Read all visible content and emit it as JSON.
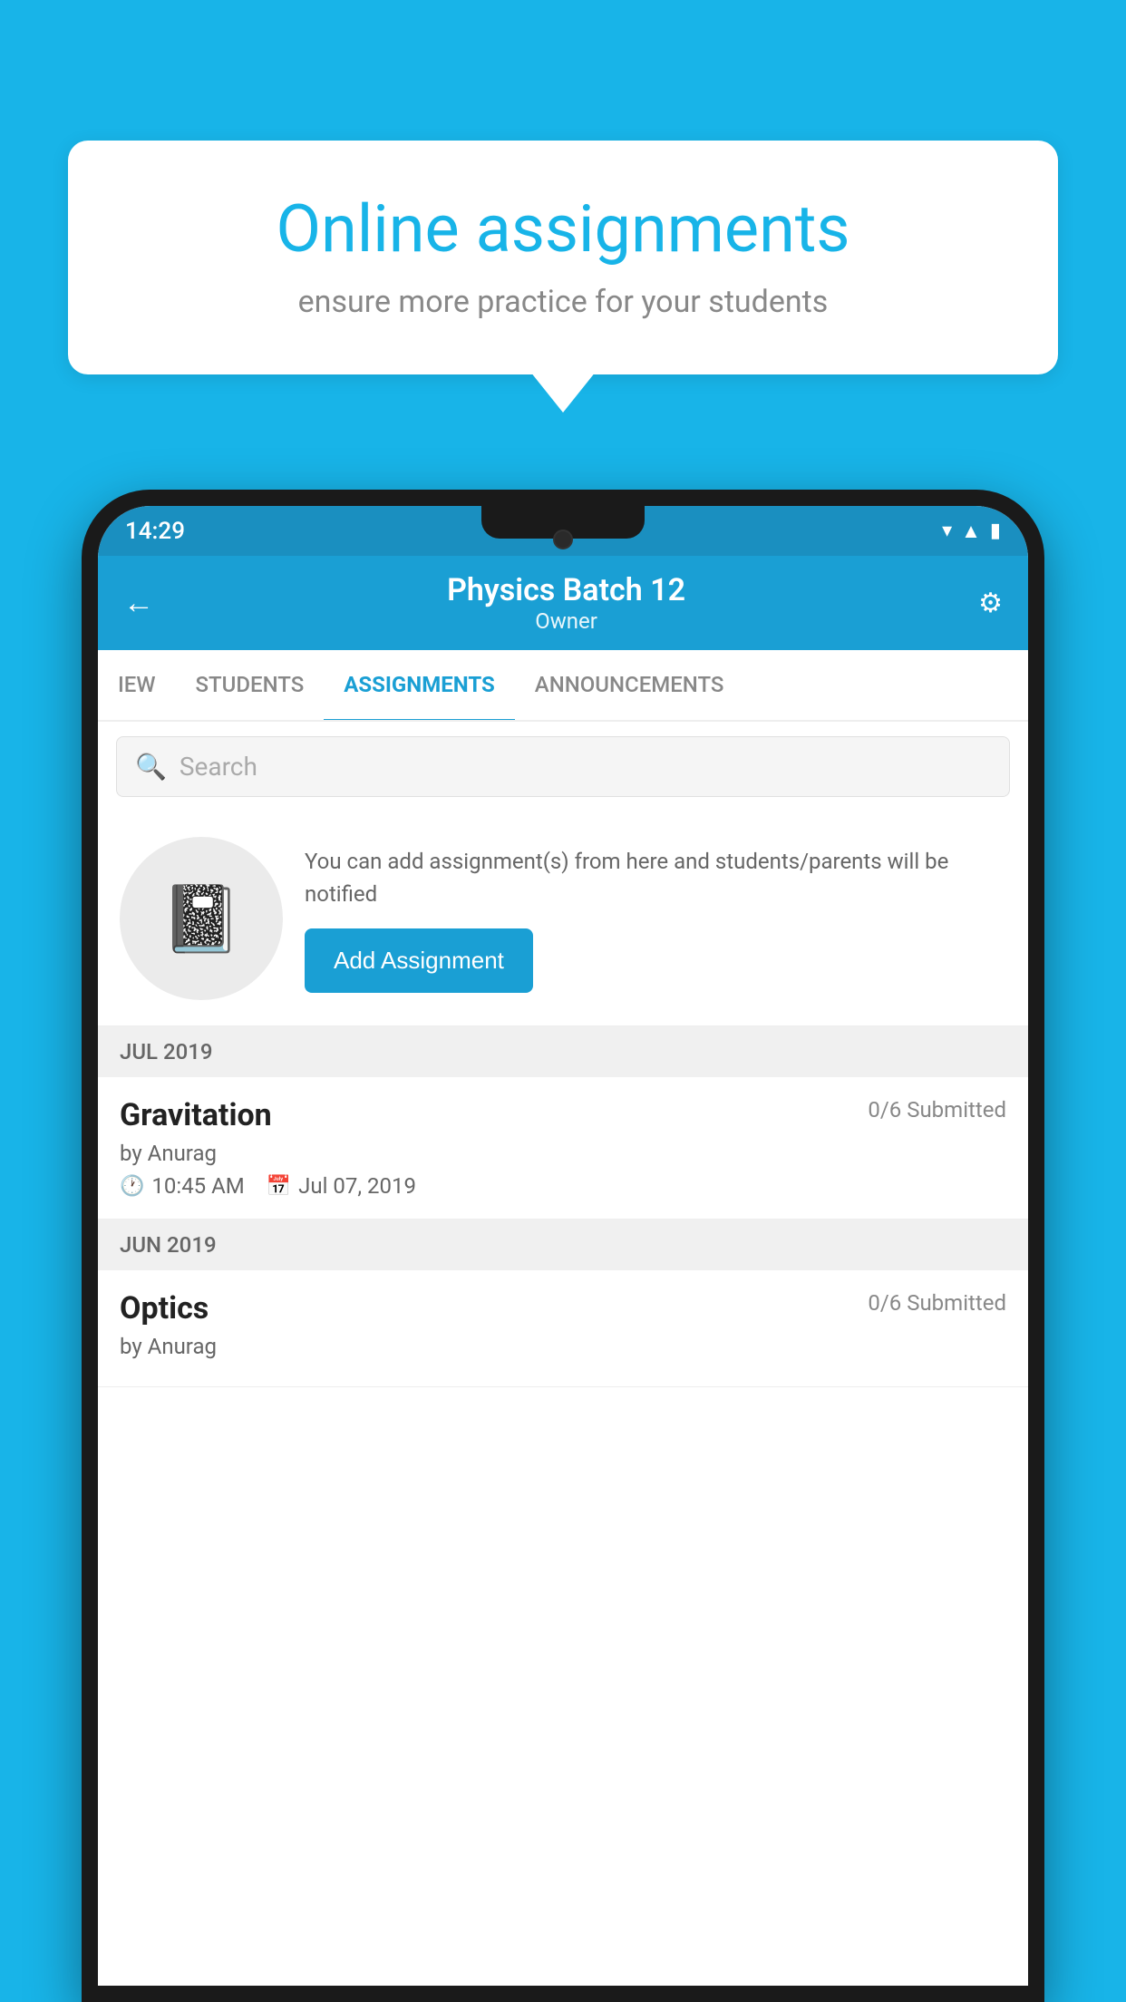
{
  "background_color": "#18b4e8",
  "speech_bubble": {
    "title": "Online assignments",
    "subtitle": "ensure more practice for your students"
  },
  "status_bar": {
    "time": "14:29",
    "icons": [
      "wifi",
      "signal",
      "battery"
    ]
  },
  "app_bar": {
    "title": "Physics Batch 12",
    "subtitle": "Owner",
    "back_label": "←",
    "settings_label": "⚙"
  },
  "tabs": [
    {
      "label": "IEW",
      "active": false
    },
    {
      "label": "STUDENTS",
      "active": false
    },
    {
      "label": "ASSIGNMENTS",
      "active": true
    },
    {
      "label": "ANNOUNCEMENTS",
      "active": false
    }
  ],
  "search": {
    "placeholder": "Search"
  },
  "promo": {
    "description": "You can add assignment(s) from here and students/parents will be notified",
    "button_label": "Add Assignment"
  },
  "sections": [
    {
      "header": "JUL 2019",
      "assignments": [
        {
          "name": "Gravitation",
          "submitted": "0/6 Submitted",
          "by": "by Anurag",
          "time": "10:45 AM",
          "date": "Jul 07, 2019"
        }
      ]
    },
    {
      "header": "JUN 2019",
      "assignments": [
        {
          "name": "Optics",
          "submitted": "0/6 Submitted",
          "by": "by Anurag",
          "time": "",
          "date": ""
        }
      ]
    }
  ]
}
